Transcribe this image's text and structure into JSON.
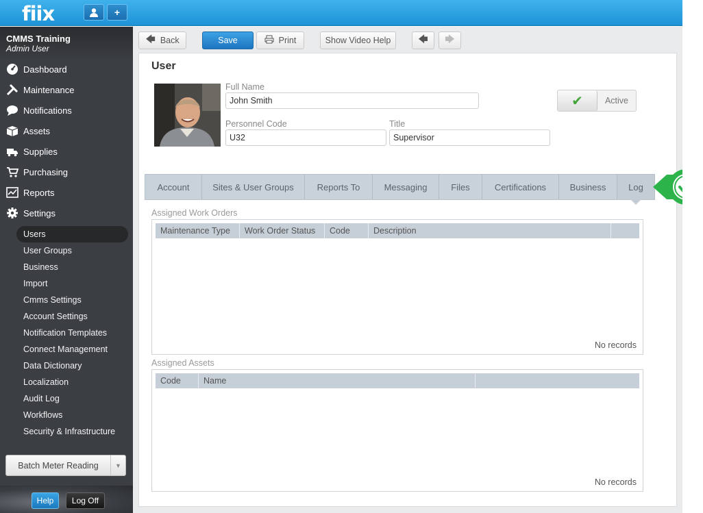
{
  "app": {
    "logo": "fiix"
  },
  "account": {
    "org": "CMMS Training",
    "role": "Admin User"
  },
  "sidebar": {
    "main": [
      {
        "label": "Dashboard",
        "icon": "dashboard-icon"
      },
      {
        "label": "Maintenance",
        "icon": "tools-icon"
      },
      {
        "label": "Notifications",
        "icon": "chat-bubble-icon"
      },
      {
        "label": "Assets",
        "icon": "box-icon"
      },
      {
        "label": "Supplies",
        "icon": "truck-icon"
      },
      {
        "label": "Purchasing",
        "icon": "cart-icon"
      },
      {
        "label": "Reports",
        "icon": "chart-icon"
      },
      {
        "label": "Settings",
        "icon": "gear-icon"
      }
    ],
    "settings_sub": [
      "Users",
      "User Groups",
      "Business",
      "Import",
      "Cmms Settings",
      "Account Settings",
      "Notification Templates",
      "Connect Management",
      "Data Dictionary",
      "Localization",
      "Audit Log",
      "Workflows",
      "Security & Infrastructure"
    ],
    "active_sub": "Users",
    "batch_label": "Batch Meter Reading",
    "help_label": "Help",
    "logoff_label": "Log Off"
  },
  "toolbar": {
    "back": "Back",
    "save": "Save",
    "print": "Print",
    "video_help": "Show Video Help"
  },
  "page": {
    "title": "User"
  },
  "form": {
    "full_name_label": "Full Name",
    "full_name": "John Smith",
    "personnel_code_label": "Personnel Code",
    "personnel_code": "U32",
    "title_label": "Title",
    "title": "Supervisor",
    "status": "Active"
  },
  "tabs": [
    "Account",
    "Sites & User Groups",
    "Reports To",
    "Messaging",
    "Files",
    "Certifications",
    "Business",
    "Log"
  ],
  "active_tab": "Log",
  "work_orders": {
    "label": "Assigned Work Orders",
    "columns": [
      "Maintenance Type",
      "Work Order Status",
      "Code",
      "Description",
      ""
    ],
    "empty": "No records"
  },
  "assets": {
    "label": "Assigned Assets",
    "columns": [
      "Code",
      "Name",
      ""
    ],
    "empty": "No records"
  },
  "colors": {
    "topbar": "#2aa3e4",
    "sidebar": "#3b3f44",
    "primary": "#1d74c0",
    "callout": "#2cb34a"
  }
}
